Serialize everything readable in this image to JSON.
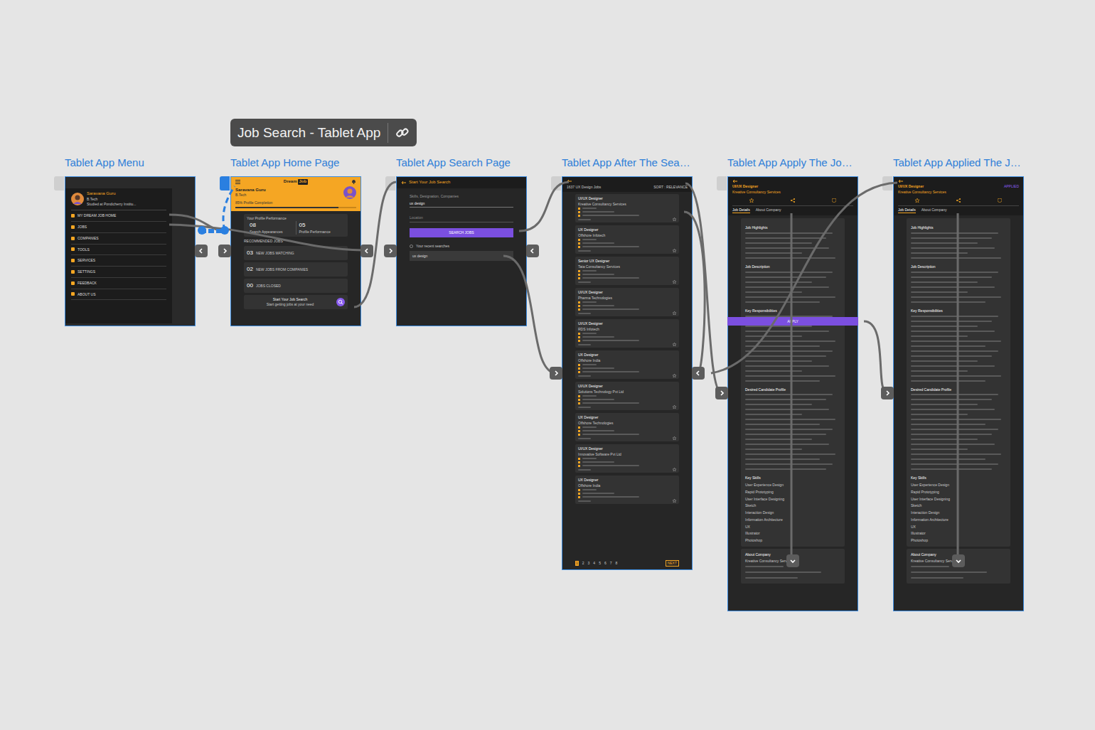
{
  "tooltip": {
    "label": "Job Search - Tablet App"
  },
  "artboards": [
    {
      "title": "Tablet App Menu",
      "kind": "menu",
      "profile": {
        "name": "Saravana Guru",
        "sub": "B.Tech",
        "detail": "Studied at Pondicherry Institu..."
      },
      "items": [
        "MY DREAM JOB HOME",
        "JOBS",
        "COMPANIES",
        "TOOLS",
        "SERVICES",
        "SETTINGS",
        "FEEDBACK",
        "ABOUT US"
      ]
    },
    {
      "title": "Tablet App Home Page",
      "kind": "home",
      "logo": "Dream",
      "logo_badge": "Job",
      "name": "Saravana Guru",
      "sub": "B.Tech",
      "progress_label": "85% Profile Completion",
      "progress": 0.85,
      "section": "Your Profile Performance",
      "stats": [
        {
          "value": "08",
          "label": "Search Appearances"
        },
        {
          "value": "05",
          "label": "Profile Performance"
        }
      ],
      "recommended": "RECOMMENDED JOBS",
      "rows": [
        {
          "value": "03",
          "label": "NEW JOBS MATCHING"
        },
        {
          "value": "02",
          "label": "NEW JOBS FROM COMPANIES"
        },
        {
          "value": "00",
          "label": "JOBS CLOSED"
        }
      ],
      "footer": "Start Your Job Search",
      "footer_sub": "Start getting jobs at your need"
    },
    {
      "title": "Tablet App Search Page",
      "kind": "search",
      "header": "Start Your Job Search",
      "field_label": "Skills, Designation, Companies",
      "field_value": "ux design",
      "location_label": "Location",
      "button": "SEARCH JOBS",
      "recent_label": "Your recent searches",
      "recent": [
        "ux design"
      ]
    },
    {
      "title": "Tablet App After The Sea…",
      "kind": "results",
      "count": "1637 UX Design Jobs",
      "sort": "SORT : RELEVANCE",
      "jobs": [
        {
          "title": "UI/UX Designer",
          "company": "Kreative Consultancy Services"
        },
        {
          "title": "UX Designer",
          "company": "Offshore Infotech"
        },
        {
          "title": "Senior UX Designer",
          "company": "Tata Consultancy Services"
        },
        {
          "title": "UI/UX Designer",
          "company": "Pharma Technologies"
        },
        {
          "title": "UI/UX Designer",
          "company": "RDS Infotech"
        },
        {
          "title": "UX Designer",
          "company": "Offshore India"
        },
        {
          "title": "UI/UX Designer",
          "company": "Solutions Technology Pvt Ltd"
        },
        {
          "title": "UX Designer",
          "company": "Offshore Technologies"
        },
        {
          "title": "UI/UX Designer",
          "company": "Innovative Software Pvt Ltd"
        },
        {
          "title": "UX Designer",
          "company": "Offshore India"
        }
      ],
      "pages": [
        "1",
        "2",
        "3",
        "4",
        "5",
        "6",
        "7",
        "8"
      ],
      "next": "NEXT"
    },
    {
      "title": "Tablet App Apply The Jo…",
      "kind": "detail",
      "applied": false,
      "job": "UI/UX Designer",
      "company": "Kreative Consultancy Services",
      "status": "APPLY",
      "tabs": [
        {
          "label": "Job Details",
          "selected": true
        },
        {
          "label": "About Company",
          "selected": false
        }
      ],
      "sections": [
        "Job Highlights",
        "Job Description",
        "Key Responsibilities",
        "Desired Candidate Profile",
        "Key Skills"
      ],
      "skills": [
        "User Experience Design",
        "Rapid Prototyping",
        "User Interface Designing",
        "Sketch",
        "Interaction Design",
        "Information Architecture",
        "UX",
        "Illustrator",
        "Photoshop"
      ],
      "about": "About Company",
      "about_name": "Kreative Consultancy Services"
    },
    {
      "title": "Tablet App Applied The J…",
      "kind": "detail",
      "applied": true,
      "job": "UI/UX Designer",
      "company": "Kreative Consultancy Services",
      "status": "APPLIED",
      "tabs": [
        {
          "label": "Job Details",
          "selected": true
        },
        {
          "label": "About Company",
          "selected": false
        }
      ],
      "sections": [
        "Job Highlights",
        "Job Description",
        "Key Responsibilities",
        "Desired Candidate Profile",
        "Key Skills"
      ],
      "skills": [
        "User Experience Design",
        "Rapid Prototyping",
        "User Interface Designing",
        "Sketch",
        "Interaction Design",
        "Information Architecture",
        "UX",
        "Illustrator",
        "Photoshop"
      ],
      "about": "About Company",
      "about_name": "Kreative Consultancy Services"
    }
  ]
}
